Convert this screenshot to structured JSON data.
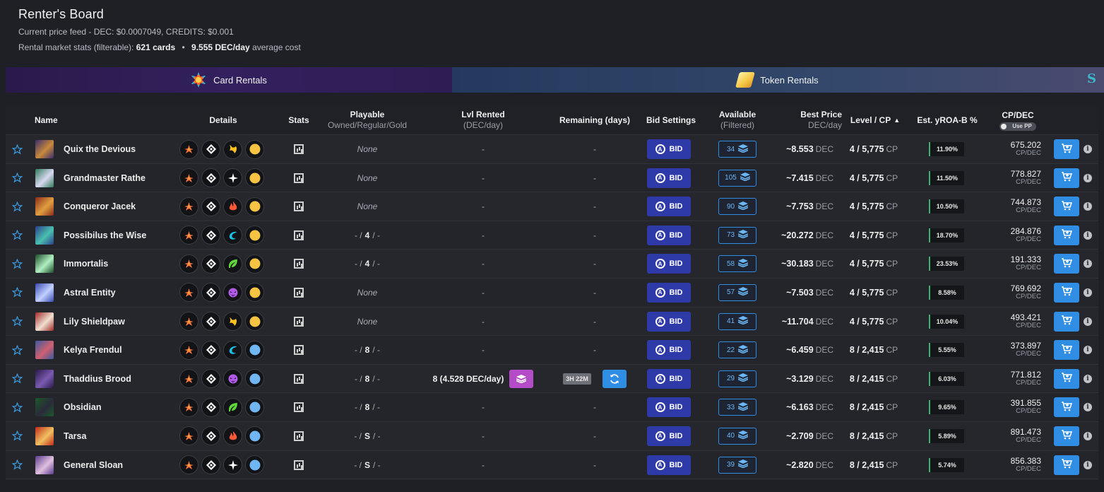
{
  "header": {
    "title": "Renter's Board",
    "price_feed": "Current price feed - DEC: $0.0007049, CREDITS: $0.001",
    "stats_prefix": "Rental market stats (filterable):",
    "cards_count": "621 cards",
    "separator": "•",
    "dec_per_day": "9.555 DEC/day",
    "stats_suffix": "average cost"
  },
  "tabs": {
    "card_rentals": "Card Rentals",
    "token_rentals": "Token Rentals",
    "edge_glyph": "S"
  },
  "columns": {
    "name": "Name",
    "details": "Details",
    "stats": "Stats",
    "playable": "Playable",
    "playable_sub": "Owned/Regular/Gold",
    "lvl_rented": "Lvl Rented",
    "lvl_rented_sub": "(DEC/day)",
    "remaining": "Remaining (days)",
    "bid_settings": "Bid Settings",
    "available": "Available",
    "available_sub": "(Filtered)",
    "best_price": "Best Price",
    "best_price_sub": "DEC/day",
    "level_cp": "Level / CP",
    "sort_arrow": "▲",
    "yroa": "Est. yROA-B %",
    "cpdec": "CP/DEC",
    "use_pp": "Use PP"
  },
  "labels": {
    "bid": "BID",
    "bid_glyph": "A",
    "dec_unit": "DEC",
    "cp_unit": "CP",
    "cpdec_unit": "CP/DEC",
    "info": "i",
    "dash": "-"
  },
  "colors": {
    "fire": "#ff5a36",
    "water": "#19c3e6",
    "life": "#ffffff",
    "earth": "#5fd63a",
    "death": "#b25ae8",
    "dragon": "#ffc21f",
    "gold": "#f6c343",
    "silver": "#70b6f5"
  },
  "rows": [
    {
      "name": "Quix the Devious",
      "element": "dragon",
      "rarity": "gold",
      "playable": "None",
      "lvl_rented": "-",
      "remaining": "-",
      "available": "34",
      "best_price": "~8.553",
      "level_cp": "4 / 5,775",
      "yroa": "11.90%",
      "cpdec": "675.202",
      "portrait": [
        "#3b2d6e",
        "#c98a3a"
      ]
    },
    {
      "name": "Grandmaster Rathe",
      "element": "life",
      "rarity": "gold",
      "playable": "None",
      "lvl_rented": "-",
      "remaining": "-",
      "available": "105",
      "best_price": "~7.415",
      "level_cp": "4 / 5,775",
      "yroa": "11.50%",
      "cpdec": "778.827",
      "portrait": [
        "#2f7a5a",
        "#d8d8f0"
      ]
    },
    {
      "name": "Conqueror Jacek",
      "element": "fire",
      "rarity": "gold",
      "playable": "None",
      "lvl_rented": "-",
      "remaining": "-",
      "available": "90",
      "best_price": "~7.753",
      "level_cp": "4 / 5,775",
      "yroa": "10.50%",
      "cpdec": "744.873",
      "portrait": [
        "#8a2a1a",
        "#e0a040"
      ]
    },
    {
      "name": "Possibilus the Wise",
      "element": "water",
      "rarity": "gold",
      "playable": "- / 4 / -",
      "lvl_rented": "-",
      "remaining": "-",
      "available": "73",
      "best_price": "~20.272",
      "level_cp": "4 / 5,775",
      "yroa": "18.70%",
      "cpdec": "284.876",
      "portrait": [
        "#2a3f8a",
        "#4ac0b0"
      ]
    },
    {
      "name": "Immortalis",
      "element": "earth",
      "rarity": "gold",
      "playable": "- / 4 / -",
      "lvl_rented": "-",
      "remaining": "-",
      "available": "58",
      "best_price": "~30.183",
      "level_cp": "4 / 5,775",
      "yroa": "23.53%",
      "cpdec": "191.333",
      "portrait": [
        "#1a4a2a",
        "#b0f0c0"
      ]
    },
    {
      "name": "Astral Entity",
      "element": "death",
      "rarity": "gold",
      "playable": "None",
      "lvl_rented": "-",
      "remaining": "-",
      "available": "57",
      "best_price": "~7.503",
      "level_cp": "4 / 5,775",
      "yroa": "8.58%",
      "cpdec": "769.692",
      "portrait": [
        "#3a4ab0",
        "#c0d0ff"
      ]
    },
    {
      "name": "Lily Shieldpaw",
      "element": "dragon",
      "rarity": "gold",
      "playable": "None",
      "lvl_rented": "-",
      "remaining": "-",
      "available": "41",
      "best_price": "~11.704",
      "level_cp": "4 / 5,775",
      "yroa": "10.04%",
      "cpdec": "493.421",
      "portrait": [
        "#a02a2a",
        "#f0e0d0"
      ]
    },
    {
      "name": "Kelya Frendul",
      "element": "water",
      "rarity": "silver",
      "playable": "- / 8 / -",
      "lvl_rented": "-",
      "remaining": "-",
      "available": "22",
      "best_price": "~6.459",
      "level_cp": "8 / 2,415",
      "yroa": "5.55%",
      "cpdec": "373.897",
      "portrait": [
        "#3a5aa0",
        "#d06070"
      ]
    },
    {
      "name": "Thaddius Brood",
      "element": "death",
      "rarity": "silver",
      "playable": "- / 8 / -",
      "lvl_rented": "8 (4.528 DEC/day)",
      "remaining": "3H 22M",
      "available": "29",
      "best_price": "~3.129",
      "level_cp": "8 / 2,415",
      "yroa": "6.03%",
      "cpdec": "771.812",
      "portrait": [
        "#2a1a4a",
        "#7a5ab0"
      ]
    },
    {
      "name": "Obsidian",
      "element": "earth",
      "rarity": "silver",
      "playable": "- / 8 / -",
      "lvl_rented": "-",
      "remaining": "-",
      "available": "33",
      "best_price": "~6.163",
      "level_cp": "8 / 2,415",
      "yroa": "9.65%",
      "cpdec": "391.855",
      "portrait": [
        "#1a5a2a",
        "#2a2a3a"
      ]
    },
    {
      "name": "Tarsa",
      "element": "fire",
      "rarity": "silver",
      "playable": "- / S / -",
      "lvl_rented": "-",
      "remaining": "-",
      "available": "40",
      "best_price": "~2.709",
      "level_cp": "8 / 2,415",
      "yroa": "5.89%",
      "cpdec": "891.473",
      "portrait": [
        "#c02a1a",
        "#f0c060"
      ]
    },
    {
      "name": "General Sloan",
      "element": "life",
      "rarity": "silver",
      "playable": "- / S / -",
      "lvl_rented": "-",
      "remaining": "-",
      "available": "39",
      "best_price": "~2.820",
      "level_cp": "8 / 2,415",
      "yroa": "5.74%",
      "cpdec": "856.383",
      "portrait": [
        "#5a3a8a",
        "#e0c0e0"
      ]
    }
  ]
}
